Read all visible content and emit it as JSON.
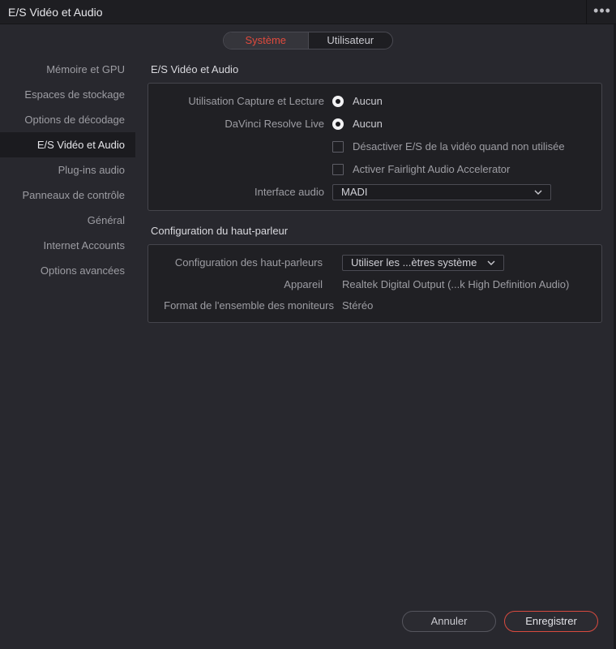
{
  "window": {
    "title": "E/S Vidéo et Audio",
    "more_icon": "more-horizontal-icon"
  },
  "tabs": [
    {
      "label": "Système",
      "active": true
    },
    {
      "label": "Utilisateur",
      "active": false
    }
  ],
  "sidebar": {
    "items": [
      {
        "label": "Mémoire et GPU",
        "active": false
      },
      {
        "label": "Espaces de stockage",
        "active": false
      },
      {
        "label": "Options de décodage",
        "active": false
      },
      {
        "label": "E/S Vidéo et Audio",
        "active": true
      },
      {
        "label": "Plug-ins audio",
        "active": false
      },
      {
        "label": "Panneaux de contrôle",
        "active": false
      },
      {
        "label": "Général",
        "active": false
      },
      {
        "label": "Internet Accounts",
        "active": false
      },
      {
        "label": "Options avancées",
        "active": false
      }
    ]
  },
  "io_section": {
    "title": "E/S Vidéo et Audio",
    "capture_label": "Utilisation Capture et Lecture",
    "capture_value": "Aucun",
    "live_label": "DaVinci Resolve Live",
    "live_value": "Aucun",
    "disable_io_label": "Désactiver E/S de la vidéo quand non utilisée",
    "disable_io_checked": false,
    "fairlight_label": "Activer Fairlight Audio Accelerator",
    "fairlight_checked": false,
    "audio_interface_label": "Interface audio",
    "audio_interface_value": "MADI"
  },
  "speaker_section": {
    "title": "Configuration du haut-parleur",
    "config_label": "Configuration des haut-parleurs",
    "config_value": "Utiliser les ...ètres système",
    "device_label": "Appareil",
    "device_value": "Realtek Digital Output (...k High Definition Audio)",
    "monitor_format_label": "Format de l'ensemble des moniteurs",
    "monitor_format_value": "Stéréo"
  },
  "footer": {
    "cancel_label": "Annuler",
    "save_label": "Enregistrer"
  },
  "colors": {
    "accent": "#e04a3d",
    "background": "#28282e",
    "panel": "#202024"
  }
}
